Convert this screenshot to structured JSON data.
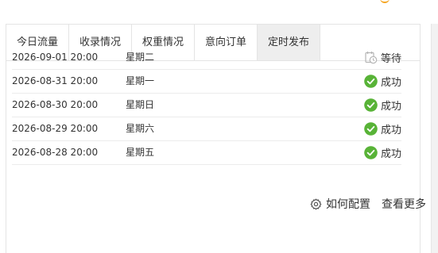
{
  "tabs": [
    {
      "label": "今日流量",
      "active": false
    },
    {
      "label": "收录情况",
      "active": false
    },
    {
      "label": "权重情况",
      "active": false
    },
    {
      "label": "意向订单",
      "active": false
    },
    {
      "label": "定时发布",
      "active": true
    }
  ],
  "schedule_rows": [
    {
      "datetime": "2026-09-01 20:00",
      "weekday": "星期二",
      "status": "等待",
      "status_icon": "pending-clock-icon"
    },
    {
      "datetime": "2026-08-31 20:00",
      "weekday": "星期一",
      "status": "成功",
      "status_icon": "success-check-icon"
    },
    {
      "datetime": "2026-08-30 20:00",
      "weekday": "星期日",
      "status": "成功",
      "status_icon": "success-check-icon"
    },
    {
      "datetime": "2026-08-29 20:00",
      "weekday": "星期六",
      "status": "成功",
      "status_icon": "success-check-icon"
    },
    {
      "datetime": "2026-08-28 20:00",
      "weekday": "星期五",
      "status": "成功",
      "status_icon": "success-check-icon"
    }
  ],
  "footer": {
    "config_label": "如何配置",
    "config_icon": "gear-icon",
    "more_label": "查看更多"
  },
  "colors": {
    "success": "#58b337",
    "pending": "#b5b5b5",
    "active_tab_bg": "#eeeeee",
    "border": "#e4e4e4",
    "accent": "#f5a623"
  }
}
